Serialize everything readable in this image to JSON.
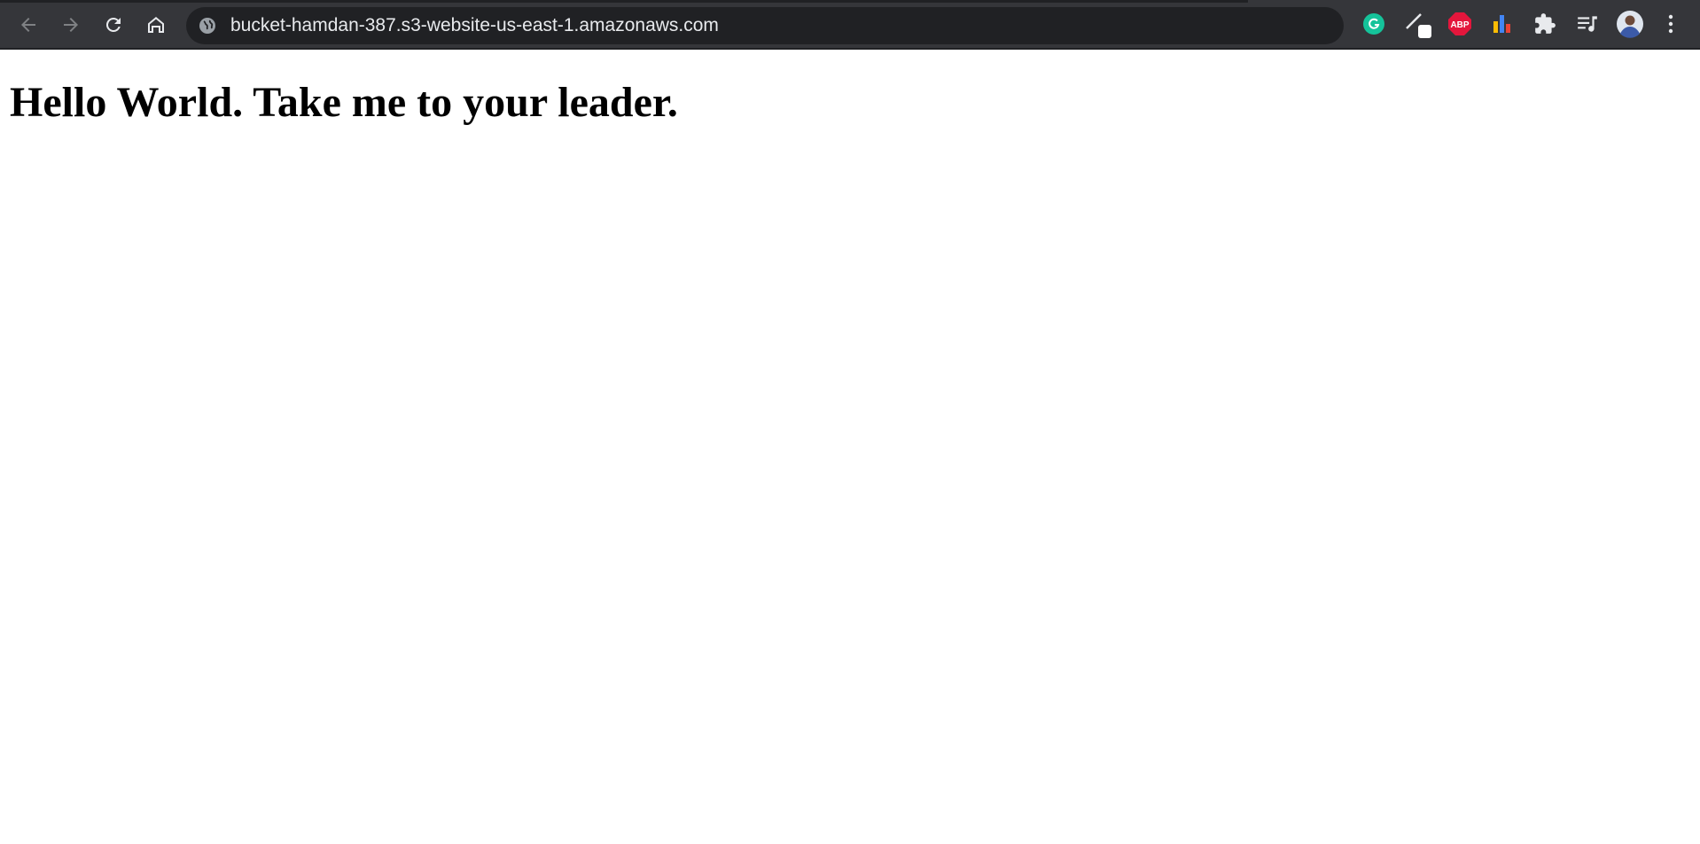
{
  "browser": {
    "url": "bucket-hamdan-387.s3-website-us-east-1.amazonaws.com",
    "nav": {
      "back_icon": "arrow-left-icon",
      "forward_icon": "arrow-right-icon",
      "reload_icon": "reload-icon",
      "home_icon": "home-icon",
      "site_info_icon": "globe-icon"
    },
    "extensions": [
      {
        "name": "grammarly-icon",
        "color": "#15c39a"
      },
      {
        "name": "pen-extension-icon",
        "color": "#e8eaed"
      },
      {
        "name": "adblock-plus-icon",
        "color": "#e4163c",
        "label": "ABP"
      },
      {
        "name": "bar-chart-extension-icon",
        "color": "#fbbc04"
      },
      {
        "name": "extensions-puzzle-icon",
        "color": "#e8eaed"
      },
      {
        "name": "media-playlist-icon",
        "color": "#e8eaed"
      },
      {
        "name": "profile-avatar-icon",
        "color": "#8ab4f8"
      },
      {
        "name": "menu-kebab-icon",
        "color": "#e8eaed"
      }
    ],
    "colors": {
      "toolbar": "#35363a",
      "omnibox": "#202124",
      "icon": "#e8eaed",
      "icon_disabled": "#7f8184"
    }
  },
  "page": {
    "heading": "Hello World. Take me to your leader."
  }
}
